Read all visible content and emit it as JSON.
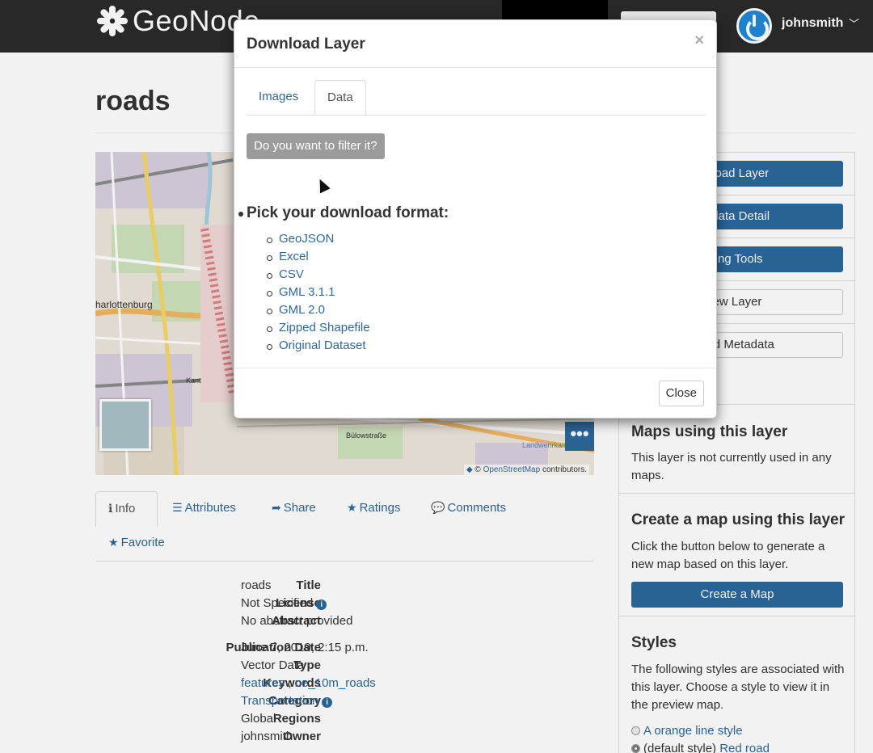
{
  "header": {
    "brand": "GeoNode",
    "user": "johnsmith"
  },
  "page": {
    "title": "roads"
  },
  "map": {
    "place_label": "harlottenburg",
    "street_labels": [
      "Kant",
      "Bülowstraße",
      "Landwehrkanal"
    ],
    "attribution_prefix": "© ",
    "attribution_link": "OpenStreetMap",
    "attribution_suffix": " contributors.",
    "more_label": "•••"
  },
  "tabs": [
    {
      "icon": "ℹ",
      "label": "Info"
    },
    {
      "icon": "☰",
      "label": "Attributes"
    },
    {
      "icon": "➦",
      "label": "Share"
    },
    {
      "icon": "★",
      "label": "Ratings"
    },
    {
      "icon": "💬",
      "label": "Comments"
    },
    {
      "icon": "★",
      "label": "Favorite"
    }
  ],
  "info": {
    "title_k": "Title",
    "title_v": "roads",
    "license_k": "License",
    "license_v": "Not Specified",
    "abstract_k": "Abstract",
    "abstract_v": "No abstract provided",
    "pubdate_k": "Publication Date",
    "pubdate_v": "June 7, 2019, 2:15 p.m.",
    "type_k": "Type",
    "type_v": "Vector Data",
    "keywords_k": "Keywords",
    "keyword1": "features",
    "keyword_sep": " , ",
    "keyword2": "ne_10m_roads",
    "category_k": "Category",
    "category_v": "Transportation",
    "regions_k": "Regions",
    "regions_v": "Global",
    "owner_k": "Owner",
    "owner_v": "johnsmith"
  },
  "sidebar": {
    "btn_download": "nload Layer",
    "btn_metadata": "adata Detail",
    "btn_editing": "ting Tools",
    "btn_view": "ew Layer",
    "btn_upload_meta": "oad Metadata",
    "maps_heading": "Maps using this layer",
    "maps_text": "This layer is not currently used in any maps.",
    "create_heading": "Create a map using this layer",
    "create_text": "Click the button below to generate a new map based on this layer.",
    "create_btn": "Create a Map",
    "styles_heading": "Styles",
    "styles_text": "The following styles are associated with this layer. Choose a style to view it in the preview map.",
    "style1": "A orange line style",
    "style2_prefix": "(default style) ",
    "style2": "Red road"
  },
  "modal": {
    "title": "Download Layer",
    "close_x": "×",
    "tab_images": "Images",
    "tab_data": "Data",
    "filter_btn": "Do you want to filter it?",
    "pick_heading": "Pick your download format:",
    "formats": [
      "GeoJSON",
      "Excel",
      "CSV",
      "GML 3.1.1",
      "GML 2.0",
      "Zipped Shapefile",
      "Original Dataset"
    ],
    "close_btn": "Close"
  },
  "colors": {
    "accent": "#2c689c",
    "navbar": "#2b2b2b",
    "filter_button": "#9b9b9b"
  }
}
